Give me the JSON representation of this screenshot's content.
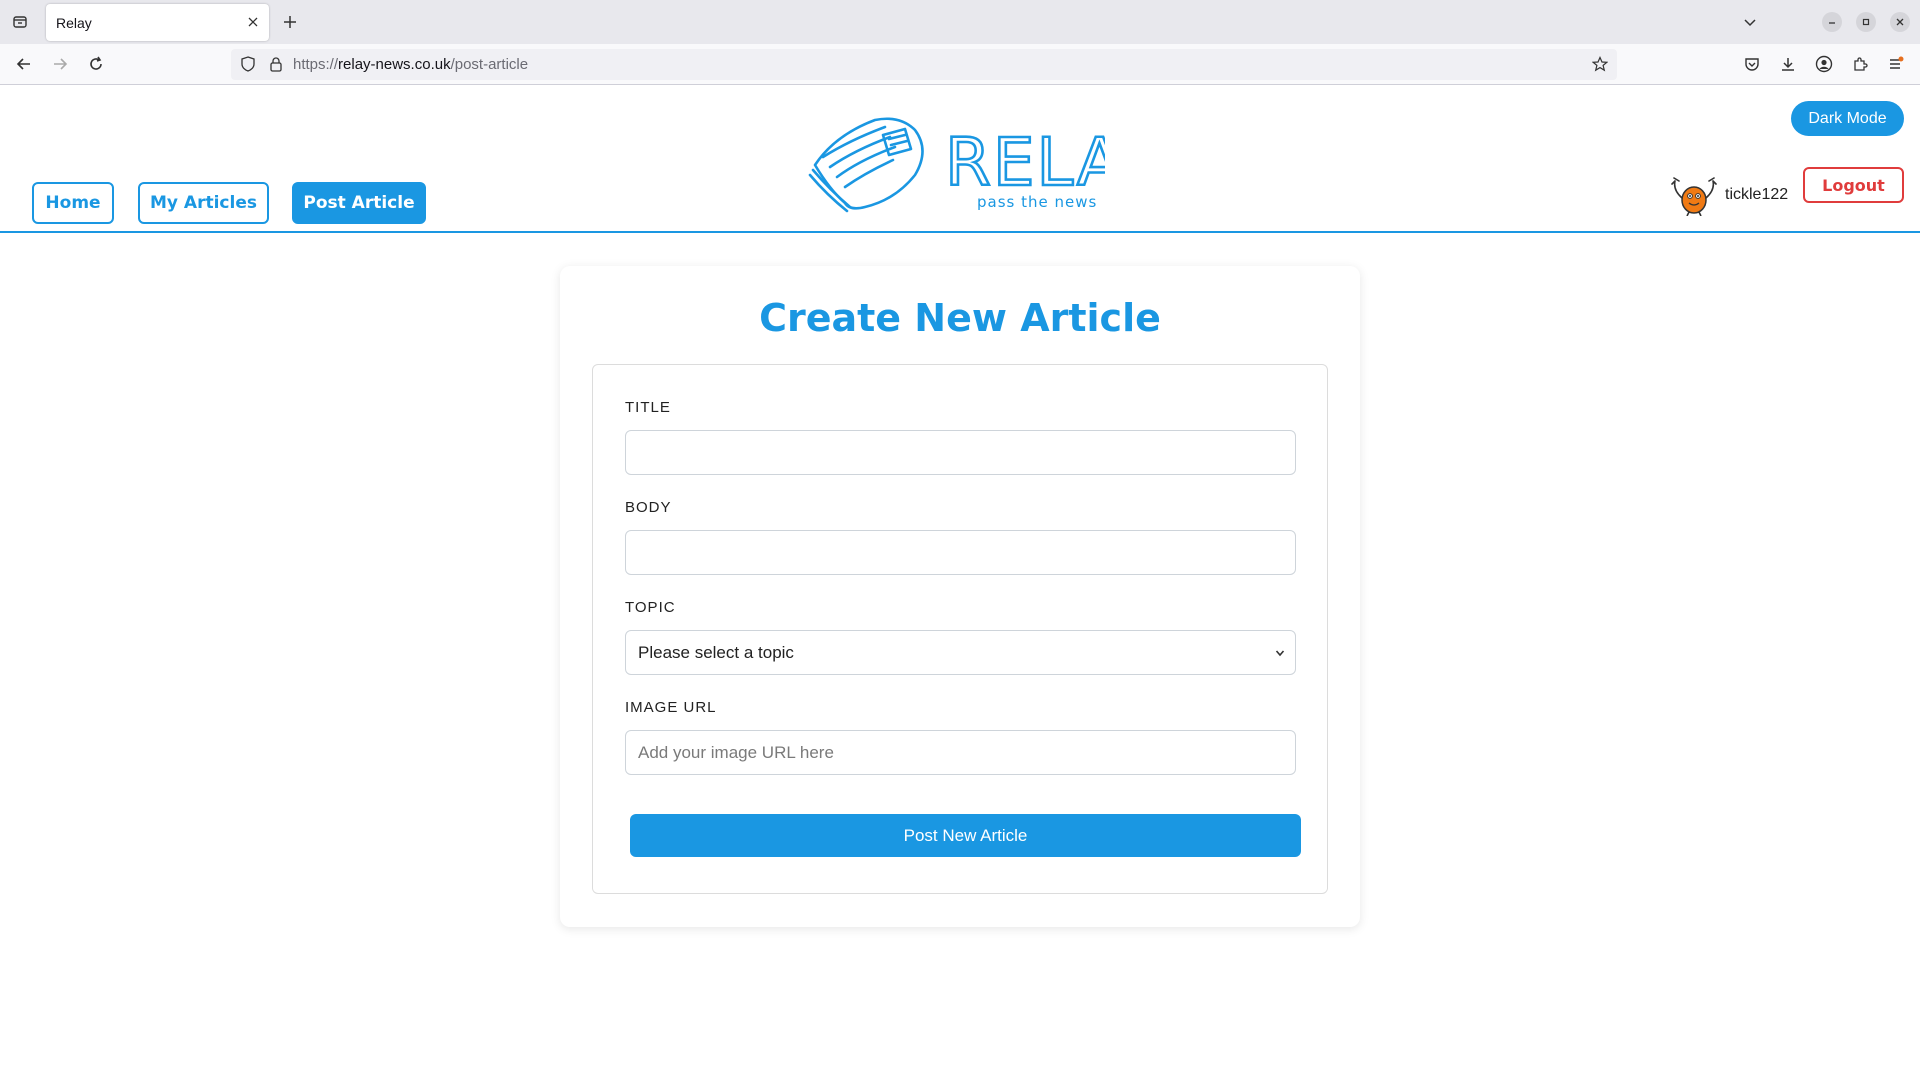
{
  "browser": {
    "tab_title": "Relay",
    "url_scheme": "https://",
    "url_host": "relay-news.co.uk",
    "url_path": "/post-article"
  },
  "header": {
    "nav": [
      {
        "label": "Home"
      },
      {
        "label": "My Articles"
      },
      {
        "label": "Post Article",
        "active": true
      }
    ],
    "logo_text": "RELAY",
    "logo_tagline": "pass the news",
    "dark_mode_label": "Dark Mode",
    "username": "tickle122",
    "logout_label": "Logout"
  },
  "form": {
    "heading": "Create New Article",
    "title_label": "TITLE",
    "title_value": "",
    "body_label": "BODY",
    "body_value": "",
    "topic_label": "TOPIC",
    "topic_selected": "Please select a topic",
    "image_label": "IMAGE URL",
    "image_placeholder": "Add your image URL here",
    "submit_label": "Post New Article"
  },
  "colors": {
    "accent": "#1a97e2",
    "danger": "#e03c3c"
  }
}
